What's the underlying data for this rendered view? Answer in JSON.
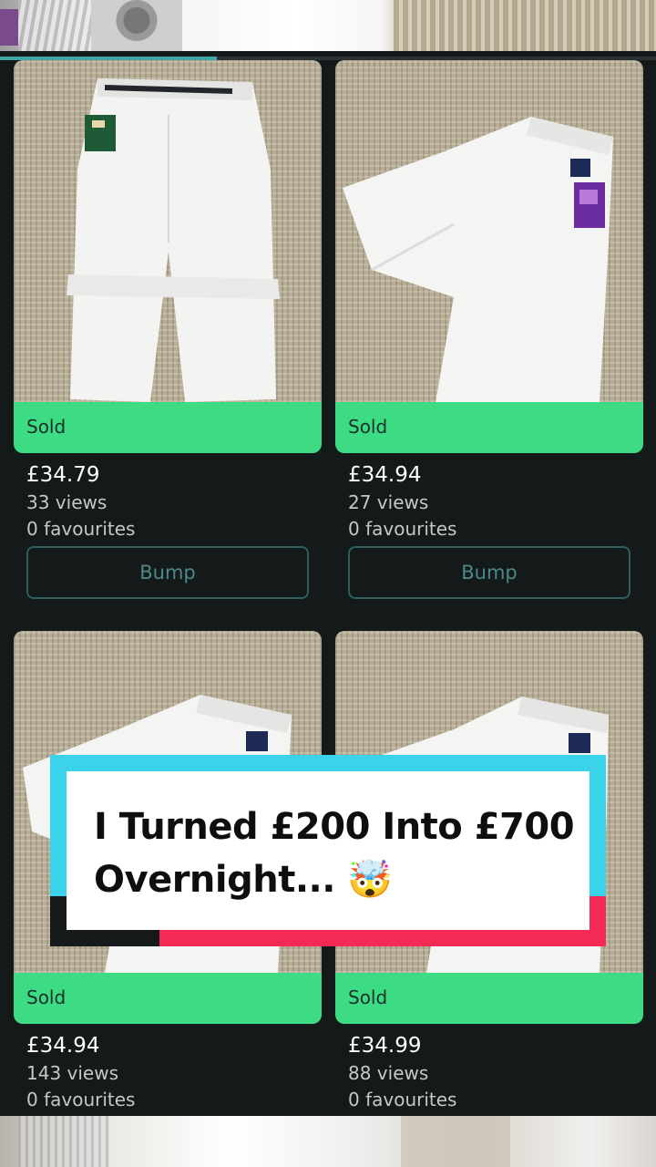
{
  "progress": 0.33,
  "listings": [
    {
      "status": "Sold",
      "price": "£34.79",
      "views": "33 views",
      "favourites": "0 favourites",
      "button": "Bump"
    },
    {
      "status": "Sold",
      "price": "£34.94",
      "views": "27 views",
      "favourites": "0 favourites",
      "button": "Bump"
    },
    {
      "status": "Sold",
      "price": "£34.94",
      "views": "143 views",
      "favourites": "0 favourites"
    },
    {
      "status": "Sold",
      "price": "£34.99",
      "views": "88 views",
      "favourites": "0 favourites"
    }
  ],
  "caption": {
    "line1": "I Turned £200 Into £700",
    "line2": "Overnight... 🤯"
  },
  "colors": {
    "sold": "#3ddc84",
    "background": "#141919",
    "caption_cyan": "#3bd3ea",
    "caption_red": "#f42a55"
  }
}
